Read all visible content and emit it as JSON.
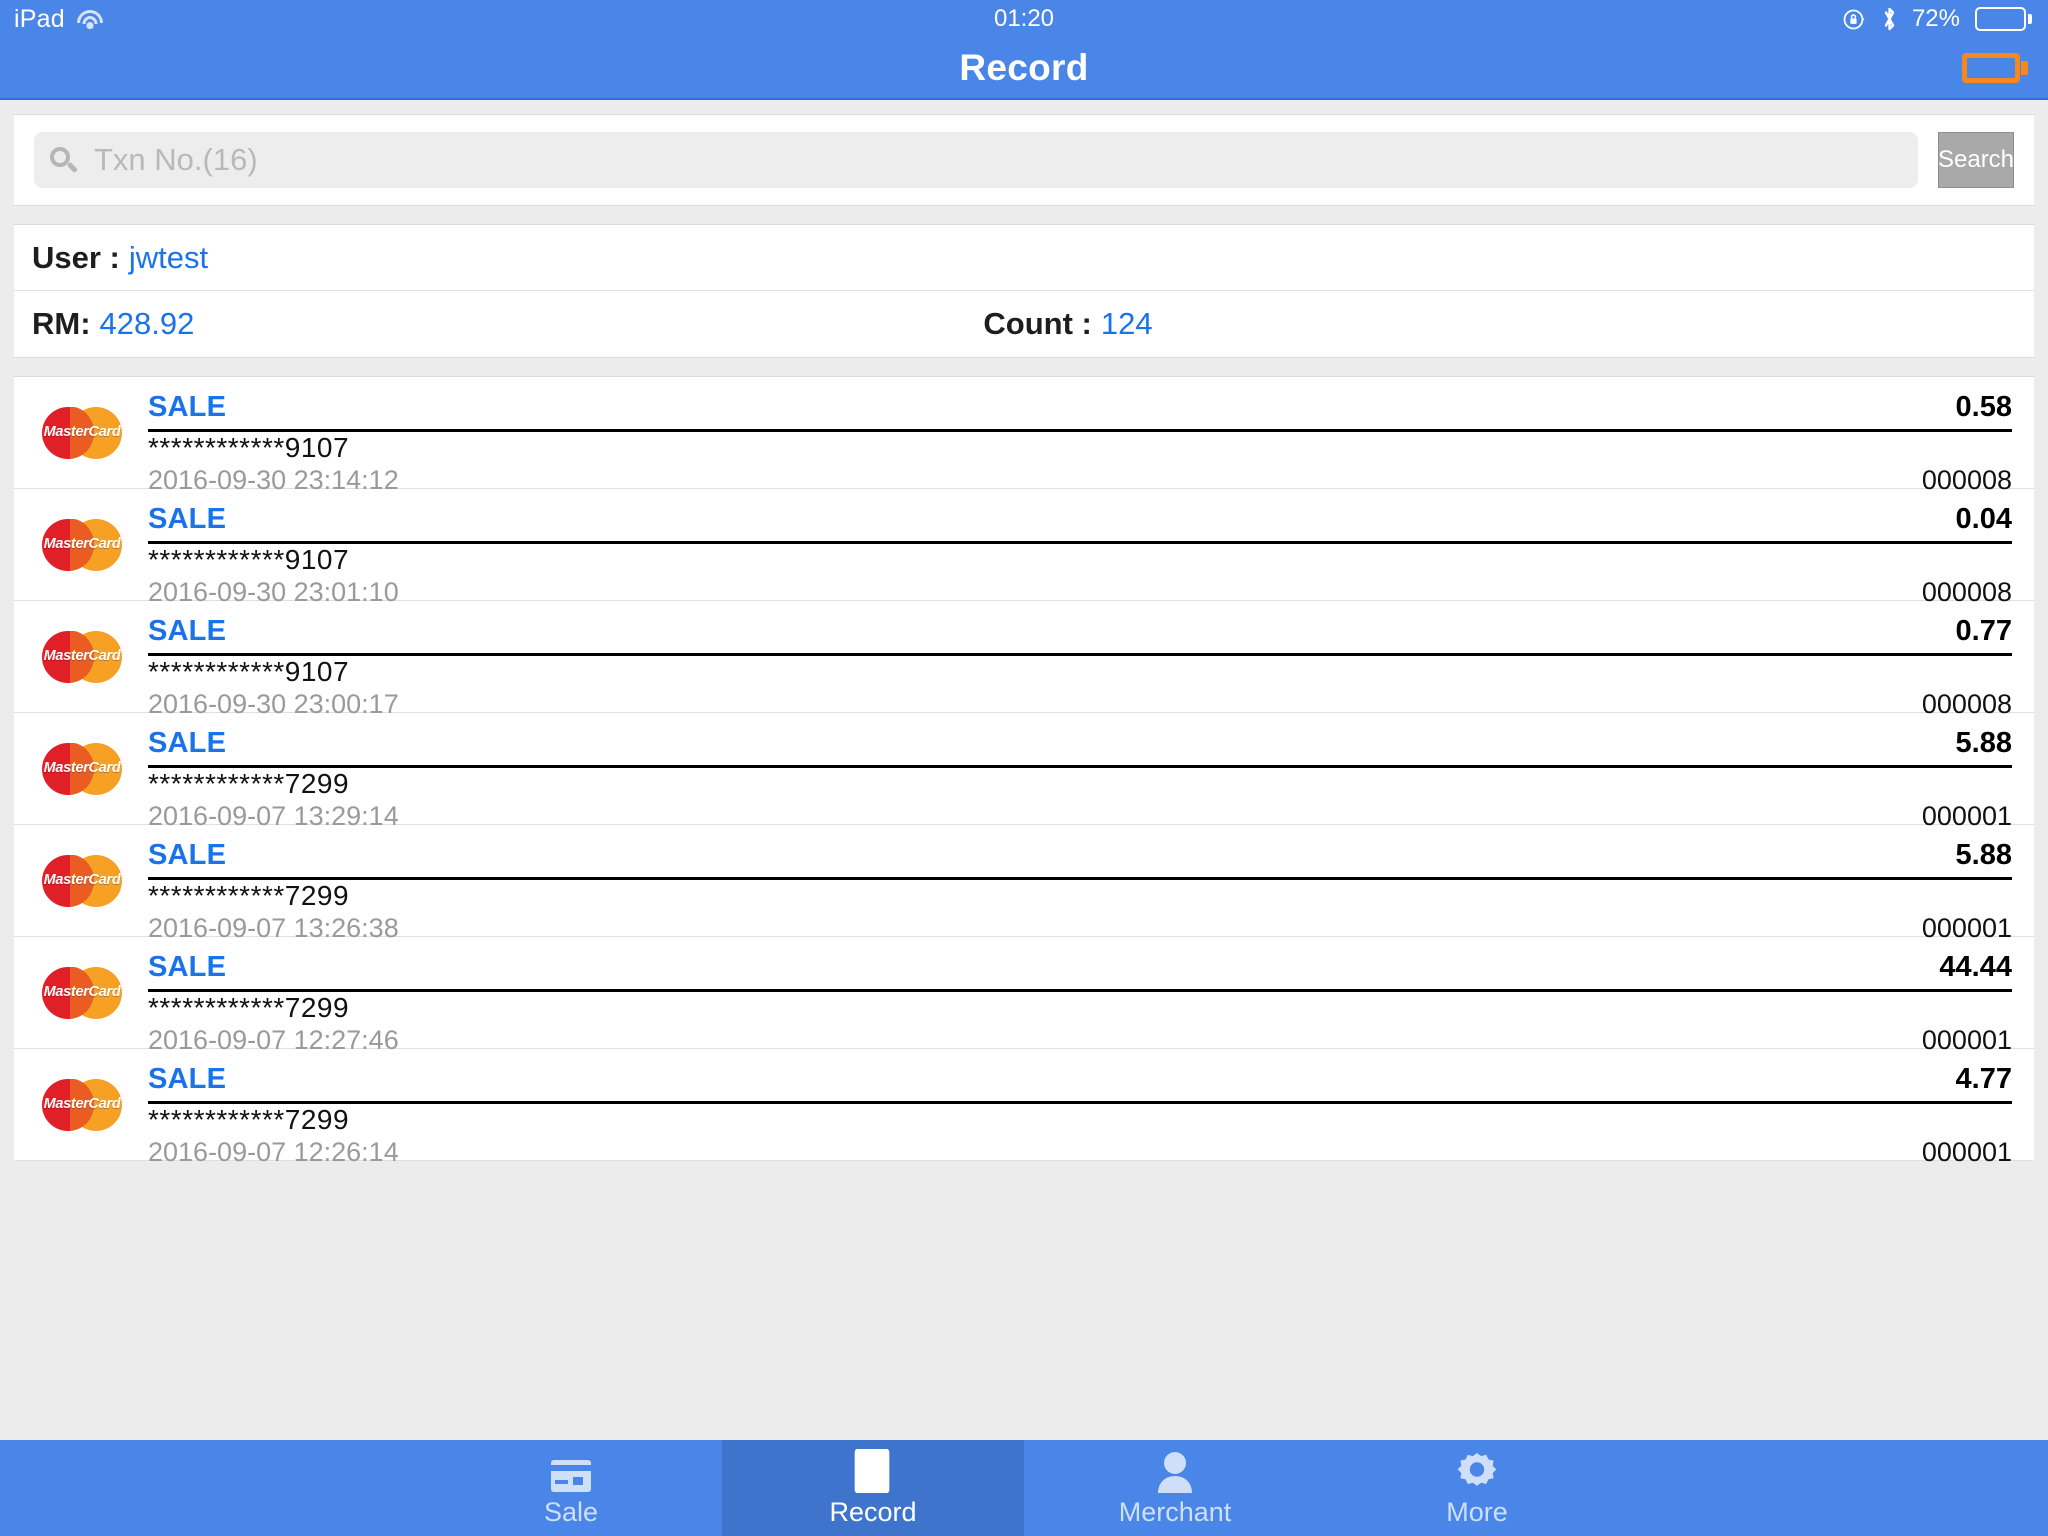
{
  "statusbar": {
    "device": "iPad",
    "wifi_icon": "wifi-icon",
    "time": "01:20",
    "rotation_lock_icon": "rotation-lock-icon",
    "bluetooth_icon": "bluetooth-icon",
    "battery_percent": "72%",
    "battery_icon": "battery-icon"
  },
  "navbar": {
    "title": "Record",
    "right_icon": "battery-outline-icon",
    "accent": "#4a86e8",
    "right_icon_color": "#f5881f"
  },
  "search": {
    "placeholder": "Txn No.(16)",
    "value": "",
    "icon": "search-icon",
    "button_label": "Search"
  },
  "summary": {
    "user_label": "User :",
    "user_value": "jwtest",
    "amount_label": "RM:",
    "amount_value": "428.92",
    "count_label": "Count :",
    "count_value": "124",
    "value_color": "#1a73e8"
  },
  "transactions": [
    {
      "brand": "MasterCard",
      "type": "SALE",
      "amount": "0.58",
      "pan": "************9107",
      "datetime": "2016-09-30 23:14:12",
      "trace": "000008"
    },
    {
      "brand": "MasterCard",
      "type": "SALE",
      "amount": "0.04",
      "pan": "************9107",
      "datetime": "2016-09-30 23:01:10",
      "trace": "000008"
    },
    {
      "brand": "MasterCard",
      "type": "SALE",
      "amount": "0.77",
      "pan": "************9107",
      "datetime": "2016-09-30 23:00:17",
      "trace": "000008"
    },
    {
      "brand": "MasterCard",
      "type": "SALE",
      "amount": "5.88",
      "pan": "************7299",
      "datetime": "2016-09-07 13:29:14",
      "trace": "000001"
    },
    {
      "brand": "MasterCard",
      "type": "SALE",
      "amount": "5.88",
      "pan": "************7299",
      "datetime": "2016-09-07 13:26:38",
      "trace": "000001"
    },
    {
      "brand": "MasterCard",
      "type": "SALE",
      "amount": "44.44",
      "pan": "************7299",
      "datetime": "2016-09-07 12:27:46",
      "trace": "000001"
    },
    {
      "brand": "MasterCard",
      "type": "SALE",
      "amount": "4.77",
      "pan": "************7299",
      "datetime": "2016-09-07 12:26:14",
      "trace": "000001"
    }
  ],
  "tabbar": {
    "items": [
      {
        "label": "Sale",
        "icon": "credit-card-icon",
        "active": false
      },
      {
        "label": "Record",
        "icon": "document-list-icon",
        "active": true
      },
      {
        "label": "Merchant",
        "icon": "person-icon",
        "active": false
      },
      {
        "label": "More",
        "icon": "gear-icon",
        "active": false
      }
    ]
  }
}
